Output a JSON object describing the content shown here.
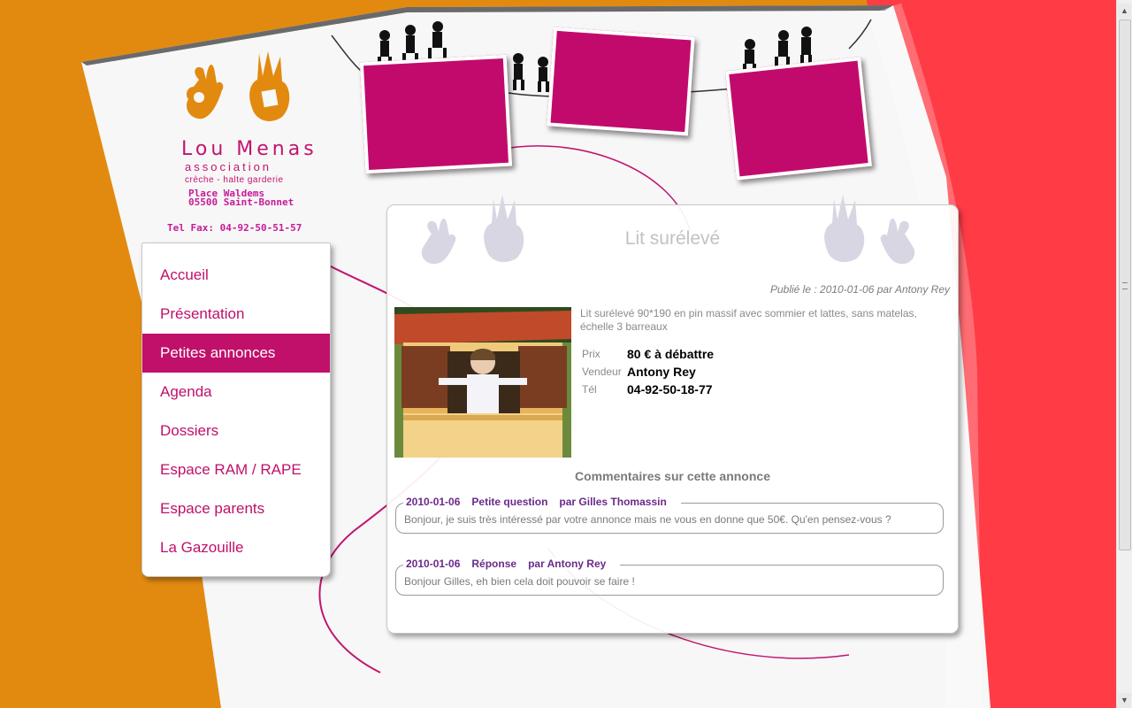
{
  "site": {
    "name": "Lou Menas",
    "tagline": "association",
    "subtitle": "crèche - halte garderie",
    "address_line1": "Place Waldems",
    "address_line2": "05500 Saint-Bonnet",
    "telfax": "Tel Fax: 04-92-50-51-57"
  },
  "nav": {
    "items": [
      {
        "label": "Accueil"
      },
      {
        "label": "Présentation"
      },
      {
        "label": "Petites annonces"
      },
      {
        "label": "Agenda"
      },
      {
        "label": "Dossiers"
      },
      {
        "label": "Espace RAM / RAPE"
      },
      {
        "label": "Espace parents"
      },
      {
        "label": "La Gazouille"
      }
    ],
    "active_index": 2
  },
  "ad": {
    "title": "Lit surélevé",
    "published_label": "Publié le : 2010-01-06 par Antony Rey",
    "description": "Lit surélevé 90*190 en pin massif avec sommier et lattes, sans matelas, échelle 3 barreaux",
    "price_label": "Prix",
    "price_value": "80 € à débattre",
    "seller_label": "Vendeur",
    "seller_value": "Antony Rey",
    "tel_label": "Tél",
    "tel_value": "04-92-50-18-77"
  },
  "comments": {
    "title": "Commentaires sur cette annonce",
    "items": [
      {
        "date": "2010-01-06",
        "subject": "Petite question",
        "author": "par Gilles Thomassin",
        "text": "Bonjour, je suis très intéressé par votre annonce mais ne vous en donne que 50€. Qu'en pensez-vous ?"
      },
      {
        "date": "2010-01-06",
        "subject": "Réponse",
        "author": "par Antony Rey",
        "text": "Bonjour Gilles, eh bien cela doit pouvoir se faire !"
      }
    ]
  },
  "colors": {
    "accent": "#c0106a",
    "orange": "#e28a10",
    "red": "#ff3b45"
  },
  "icons": [
    "hand-logo-icon",
    "kids-silhouette-icon",
    "handprint-deco-icon",
    "scroll-up-icon",
    "scroll-down-icon"
  ]
}
